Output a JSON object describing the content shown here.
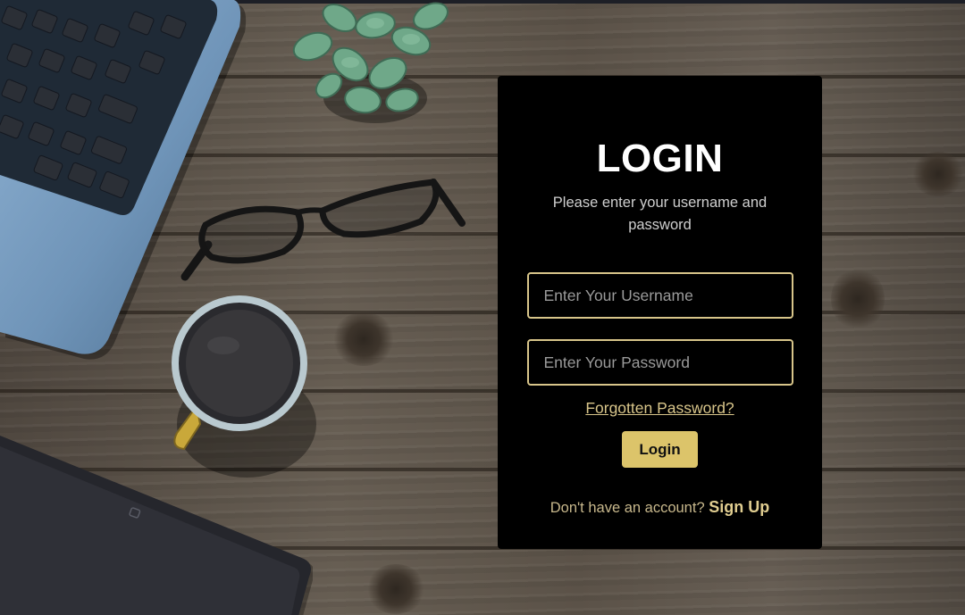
{
  "login": {
    "title": "LOGIN",
    "subtitle": "Please enter your username and password",
    "username_placeholder": "Enter Your Username",
    "password_placeholder": "Enter Your Password",
    "forgot_label": "Forgotten Password?",
    "button_label": "Login",
    "signup_prompt": "Don't have an account?",
    "signup_label": "Sign Up"
  },
  "colors": {
    "card_background": "#000000",
    "accent_gold": "#dcc46a",
    "input_border": "#d8c58a",
    "wood_background": "#5e554b"
  },
  "icons": [
    "laptop-keyboard-image",
    "plant-image",
    "eyeglasses-image",
    "coffee-cup-image",
    "tablet-image"
  ]
}
